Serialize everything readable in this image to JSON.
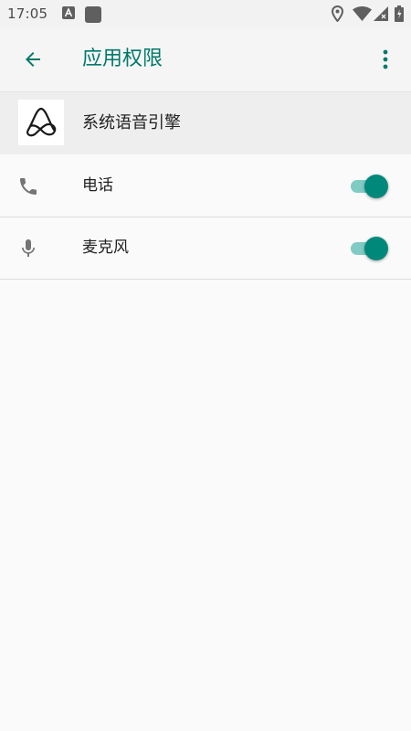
{
  "status_bar": {
    "time": "17:05",
    "icons": [
      "a-notification-icon",
      "square-notification-icon",
      "location-icon",
      "wifi-icon",
      "signal-icon",
      "battery-icon"
    ]
  },
  "app_bar": {
    "title": "应用权限",
    "back_icon": "arrow-back-icon",
    "more_icon": "more-vert-icon"
  },
  "app": {
    "name": "系统语音引擎",
    "icon": "app-logo-icon"
  },
  "permissions": [
    {
      "label": "电话",
      "icon": "phone-icon",
      "enabled": true
    },
    {
      "label": "麦克风",
      "icon": "mic-icon",
      "enabled": true
    }
  ],
  "colors": {
    "accent": "#00796b",
    "toggle_thumb": "#00897b",
    "toggle_track": "#80cbc4",
    "icon_gray": "#757575"
  }
}
